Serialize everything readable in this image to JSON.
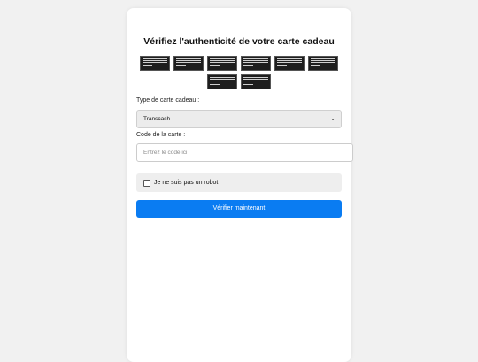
{
  "title": "Vérifiez l'authenticité de votre carte cadeau",
  "logos": {
    "icon": "gift-card-logo",
    "count": 8
  },
  "form": {
    "type_label": "Type de carte cadeau :",
    "type_selected": "Transcash",
    "code_label": "Code de la carte :",
    "code_placeholder": "Entrez le code ici",
    "captcha_label": "Je ne suis pas un robot",
    "submit_label": "Vérifier maintenant"
  },
  "colors": {
    "accent": "#0a7cf2",
    "background": "#f1f1f1",
    "card": "#ffffff"
  }
}
